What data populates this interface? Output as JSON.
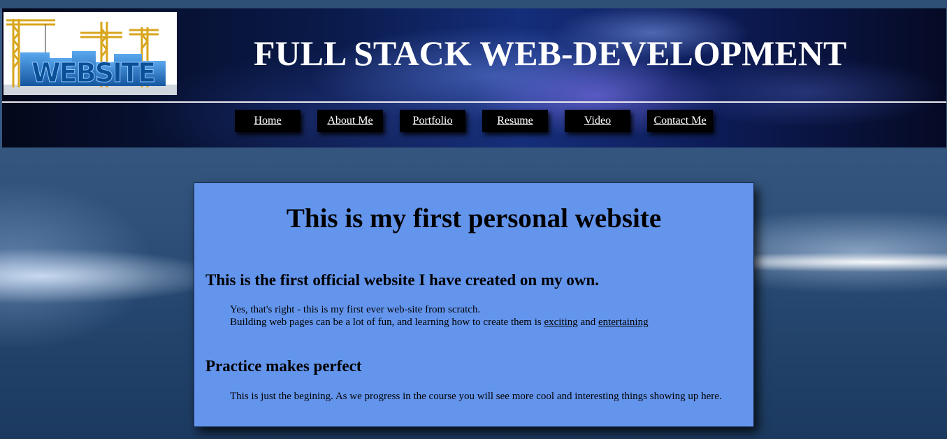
{
  "header": {
    "logo_text": "WEBSITE",
    "title": "FULL STACK WEB-DEVELOPMENT"
  },
  "nav": {
    "items": [
      {
        "label": "Home"
      },
      {
        "label": "About Me"
      },
      {
        "label": "Portfolio"
      },
      {
        "label": "Resume"
      },
      {
        "label": "Video"
      },
      {
        "label": "Contact Me"
      }
    ]
  },
  "main": {
    "heading": "This is my first personal website",
    "sections": [
      {
        "heading": "This is the first official website I have created on my own.",
        "line1": "Yes, that's right - this is my first ever web-site from scratch.",
        "line2_prefix": "Building web pages can be a lot of fun, and learning how to create them is ",
        "link1": "exciting",
        "connector": " and ",
        "link2": "entertaining"
      },
      {
        "heading": "Practice makes perfect",
        "text": "This is just the begining. As we progress in the course you will see more cool and interesting things showing up here."
      }
    ]
  },
  "colors": {
    "content_background": "#6495ed",
    "nav_background": "#000000",
    "title_text": "#ffffff",
    "logo_blue": "#1e6fc0",
    "crane_yellow": "#e0b020"
  },
  "icons": {
    "logo": "construction-cranes-website-logo"
  }
}
